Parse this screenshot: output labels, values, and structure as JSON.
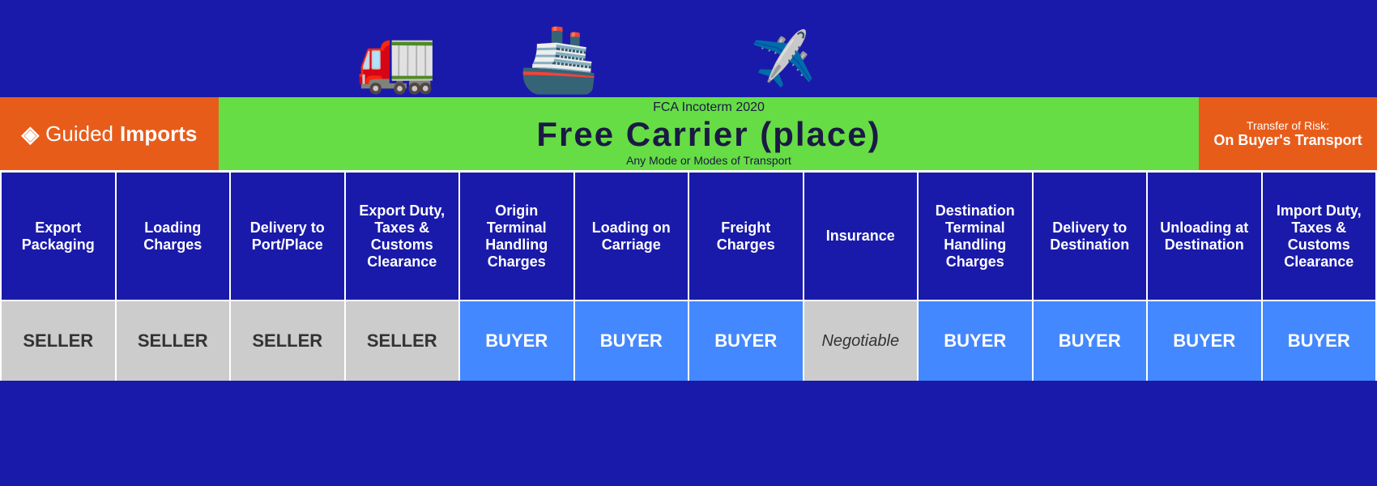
{
  "logo": {
    "guided": "Guided",
    "imports": "Imports",
    "icon": "◈"
  },
  "header": {
    "incoterm_label": "FCA Incoterm 2020",
    "incoterm_title": "Free Carrier (place)",
    "incoterm_subtitle": "Any Mode or Modes of Transport"
  },
  "risk": {
    "label": "Transfer of Risk:",
    "value": "On Buyer's Transport"
  },
  "columns": [
    {
      "id": "export-packaging",
      "label": "Export Packaging"
    },
    {
      "id": "loading-charges",
      "label": "Loading Charges"
    },
    {
      "id": "delivery-port",
      "label": "Delivery to Port/Place"
    },
    {
      "id": "export-duty",
      "label": "Export Duty, Taxes & Customs Clearance"
    },
    {
      "id": "origin-terminal",
      "label": "Origin Terminal Handling Charges"
    },
    {
      "id": "loading-carriage",
      "label": "Loading on Carriage"
    },
    {
      "id": "freight-charges",
      "label": "Freight Charges"
    },
    {
      "id": "insurance",
      "label": "Insurance"
    },
    {
      "id": "dest-terminal",
      "label": "Destination Terminal Handling Charges"
    },
    {
      "id": "delivery-dest",
      "label": "Delivery to Destination"
    },
    {
      "id": "unloading-dest",
      "label": "Unloading at Destination"
    },
    {
      "id": "import-duty",
      "label": "Import Duty, Taxes & Customs Clearance"
    }
  ],
  "values": [
    {
      "id": "export-packaging-val",
      "label": "SELLER",
      "type": "seller"
    },
    {
      "id": "loading-charges-val",
      "label": "SELLER",
      "type": "seller"
    },
    {
      "id": "delivery-port-val",
      "label": "SELLER",
      "type": "seller"
    },
    {
      "id": "export-duty-val",
      "label": "SELLER",
      "type": "seller"
    },
    {
      "id": "origin-terminal-val",
      "label": "BUYER",
      "type": "buyer"
    },
    {
      "id": "loading-carriage-val",
      "label": "BUYER",
      "type": "buyer"
    },
    {
      "id": "freight-charges-val",
      "label": "BUYER",
      "type": "buyer"
    },
    {
      "id": "insurance-val",
      "label": "Negotiable",
      "type": "negotiable"
    },
    {
      "id": "dest-terminal-val",
      "label": "BUYER",
      "type": "buyer"
    },
    {
      "id": "delivery-dest-val",
      "label": "BUYER",
      "type": "buyer"
    },
    {
      "id": "unloading-dest-val",
      "label": "BUYER",
      "type": "buyer"
    },
    {
      "id": "import-duty-val",
      "label": "BUYER",
      "type": "buyer"
    }
  ],
  "icons": {
    "truck": "🚚",
    "ship": "🚢",
    "plane": "✈️"
  }
}
